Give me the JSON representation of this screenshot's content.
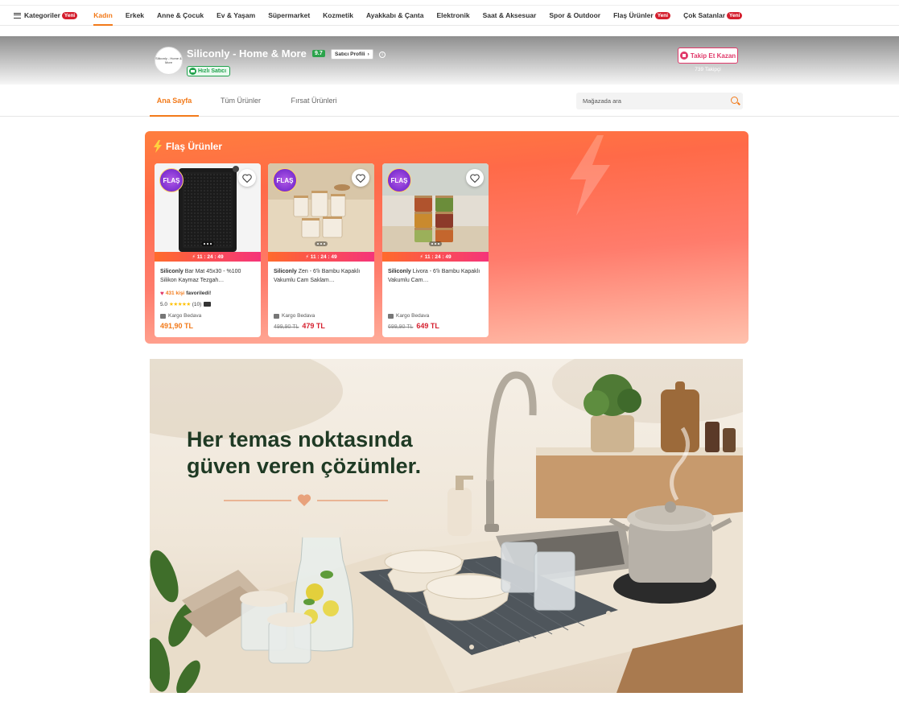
{
  "topnav": {
    "categories_label": "Kategoriler",
    "categories_badge": "Yeni",
    "items": [
      {
        "label": "Kadın"
      },
      {
        "label": "Erkek"
      },
      {
        "label": "Anne & Çocuk"
      },
      {
        "label": "Ev & Yaşam"
      },
      {
        "label": "Süpermarket"
      },
      {
        "label": "Kozmetik"
      },
      {
        "label": "Ayakkabı & Çanta"
      },
      {
        "label": "Elektronik"
      },
      {
        "label": "Saat & Aksesuar"
      },
      {
        "label": "Spor & Outdoor"
      },
      {
        "label": "Flaş Ürünler",
        "badge": "Yeni"
      },
      {
        "label": "Çok Satanlar",
        "badge": "Yeni"
      }
    ],
    "active": "Kadın"
  },
  "seller": {
    "logo_text": "Siliconly - Home & More",
    "name": "Siliconly - Home & More",
    "score": "9.7",
    "profile_button": "Satıcı Profili",
    "profile_chevron": "›",
    "info_icon": "info-icon",
    "fast_seller": "Hızlı Satıcı",
    "follow_button": "Takip Et Kazan",
    "followers": "739 Takipçi"
  },
  "tabs": [
    {
      "label": "Ana Sayfa",
      "active": true
    },
    {
      "label": "Tüm Ürünler",
      "active": false
    },
    {
      "label": "Fırsat Ürünleri",
      "active": false
    }
  ],
  "search": {
    "placeholder": "Mağazada ara",
    "value": ""
  },
  "flash": {
    "title": "Flaş Ürünler",
    "badge_text": "FLAŞ",
    "products": [
      {
        "brand": "Siliconly",
        "name": "Bar Mat 45x30 - %100 Silikon Kaymaz Tezgah…",
        "timer": "11 : 24 : 49",
        "favorites_count": "431 kişi",
        "favorites_label": "favoriledi!",
        "rating": "5.0",
        "stars": "★★★★★",
        "reviews": "(10)",
        "cargo": "Kargo Bedava",
        "old_price": "",
        "price": "491,90 TL"
      },
      {
        "brand": "Siliconly",
        "name": "Zen - 6'lı Bambu Kapaklı Vakumlu Cam Saklam…",
        "timer": "11 : 24 : 49",
        "cargo": "Kargo Bedava",
        "old_price": "499,90 TL",
        "price": "479 TL"
      },
      {
        "brand": "Siliconly",
        "name": "Livora - 6'lı Bambu Kapaklı Vakumlu Cam…",
        "timer": "11 : 24 : 49",
        "cargo": "Kargo Bedava",
        "old_price": "699,90 TL",
        "price": "649 TL"
      }
    ]
  },
  "banner": {
    "headline": "Her temas noktasında\ngüven veren çözümler."
  },
  "colors": {
    "accent": "#f27a1a",
    "badge": "#d51f2e",
    "success": "#1fa14b",
    "follow": "#e0396a"
  }
}
